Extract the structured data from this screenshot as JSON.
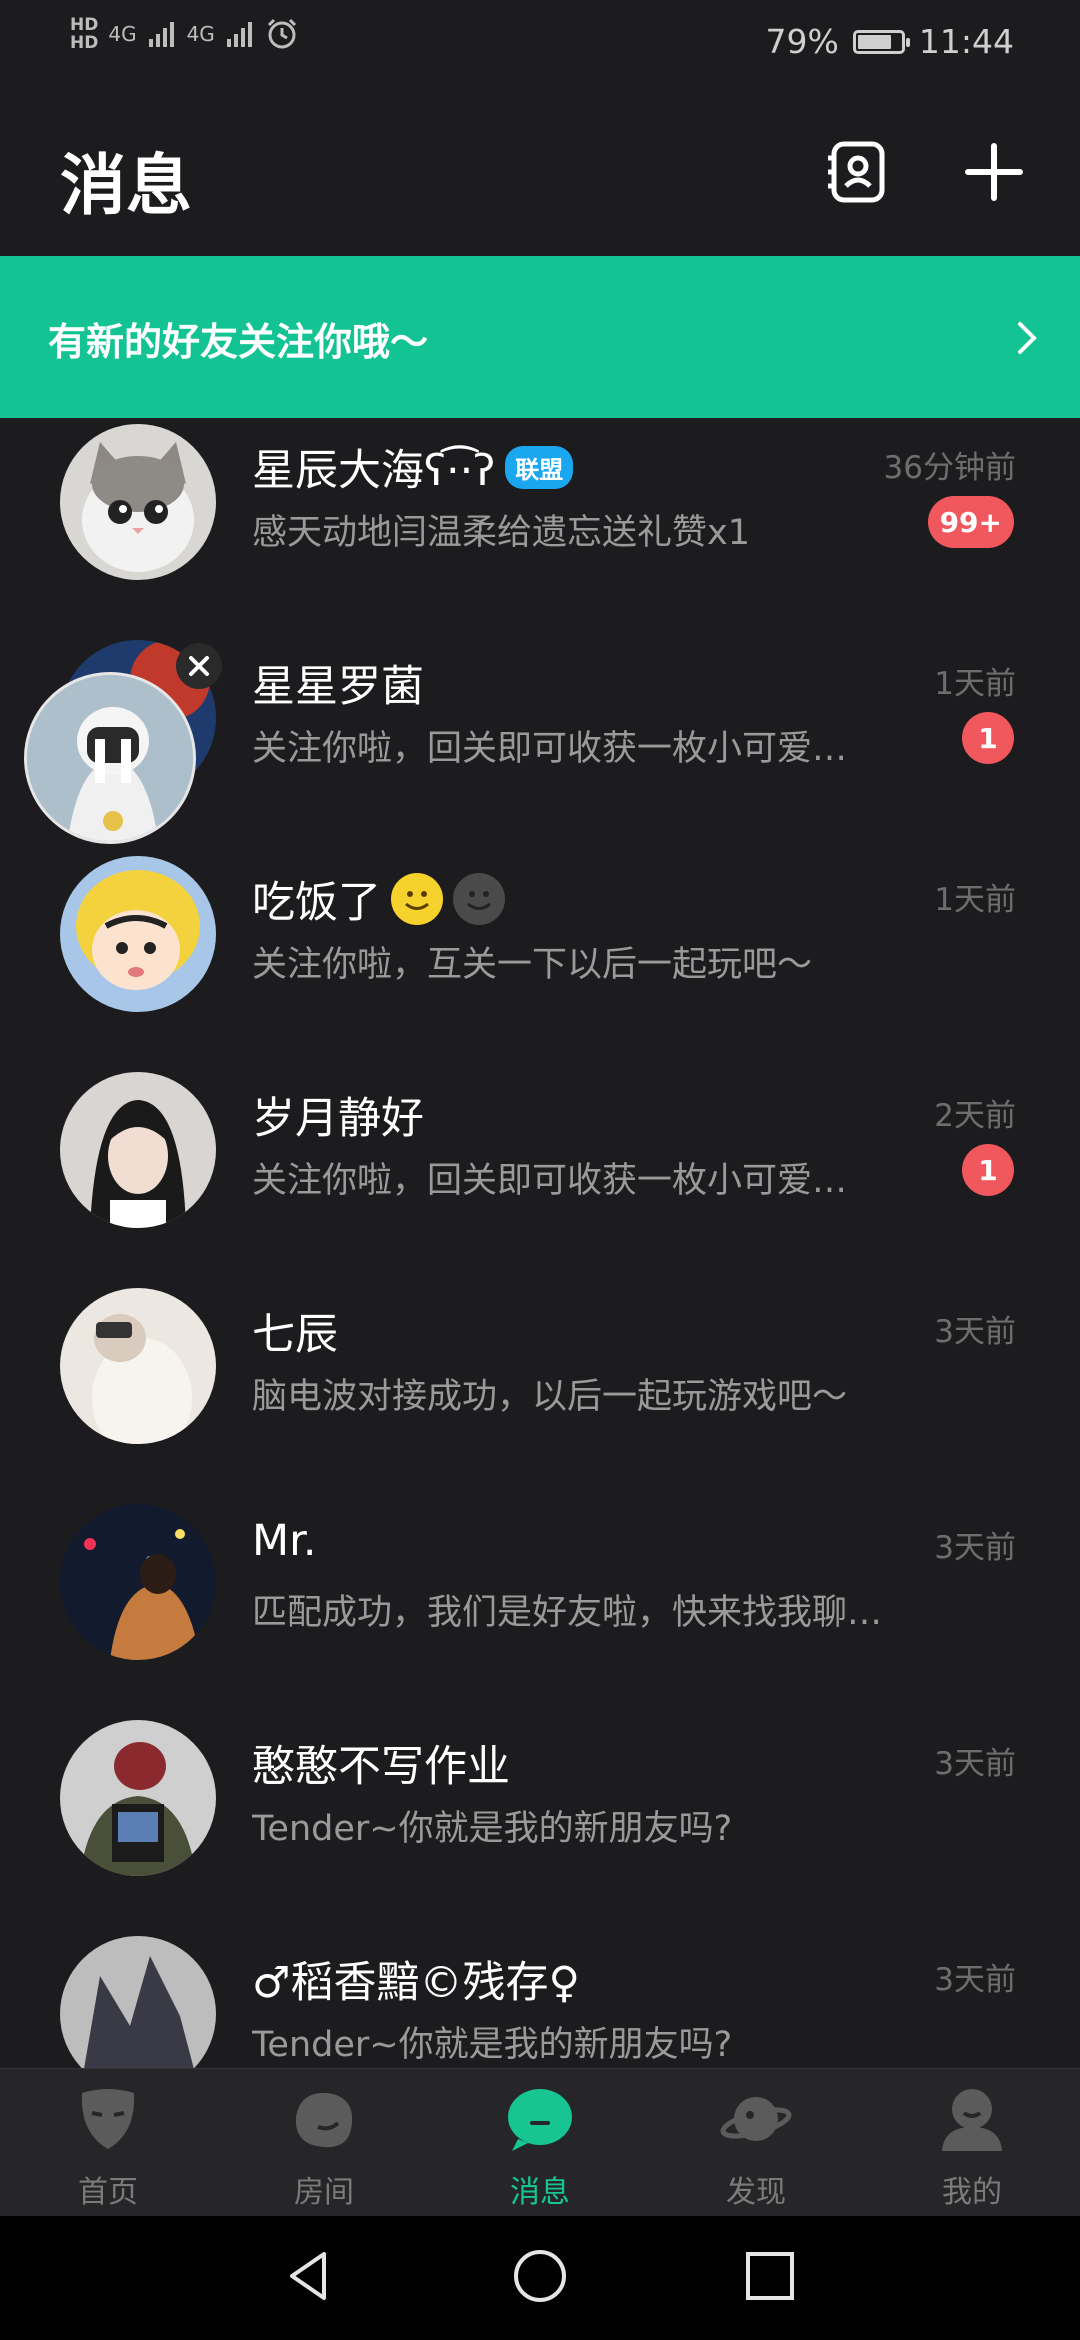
{
  "status_bar": {
    "hd1": "HD",
    "hd2": "HD",
    "net1": "4G",
    "net2": "4G",
    "battery_percent": "79%",
    "battery_level": 0.79,
    "time": "11:44"
  },
  "header": {
    "title": "消息",
    "icons": [
      "contacts-icon",
      "add-icon"
    ]
  },
  "banner": {
    "text": "有新的好友关注你哦～"
  },
  "conversations": [
    {
      "name": "星辰大海ʕ·͡·ʔ",
      "tag": "联盟",
      "preview": "感天动地闫温柔给遗忘送礼赞x1",
      "time": "36分钟前",
      "badge": "99+"
    },
    {
      "name": "星星罗菌",
      "preview": "关注你啦，回关即可收获一枚小可爱…",
      "time": "1天前",
      "badge": "1"
    },
    {
      "name": "吃饭了",
      "preview": "关注你啦，互关一下以后一起玩吧～",
      "time": "1天前",
      "badge": ""
    },
    {
      "name": "岁月静好",
      "preview": "关注你啦，回关即可收获一枚小可爱…",
      "time": "2天前",
      "badge": "1"
    },
    {
      "name": "七辰",
      "preview": "脑电波对接成功，以后一起玩游戏吧～",
      "time": "3天前",
      "badge": ""
    },
    {
      "name": "Mr.",
      "preview": "匹配成功，我们是好友啦，快来找我聊…",
      "time": "3天前",
      "badge": ""
    },
    {
      "name": "憨憨不写作业",
      "preview": "Tender~你就是我的新朋友吗?",
      "time": "3天前",
      "badge": ""
    },
    {
      "name": "♂稻香黯©残存♀",
      "preview": "Tender~你就是我的新朋友吗?",
      "time": "3天前",
      "badge": ""
    }
  ],
  "tabs": [
    {
      "label": "首页",
      "icon": "mask-icon"
    },
    {
      "label": "房间",
      "icon": "room-icon"
    },
    {
      "label": "消息",
      "icon": "message-icon",
      "active": true
    },
    {
      "label": "发现",
      "icon": "planet-icon"
    },
    {
      "label": "我的",
      "icon": "profile-icon"
    }
  ],
  "colors": {
    "accent": "#14c393",
    "background": "#1c1c1e",
    "badge": "#f1585d",
    "tag": "#1aa7f0"
  }
}
